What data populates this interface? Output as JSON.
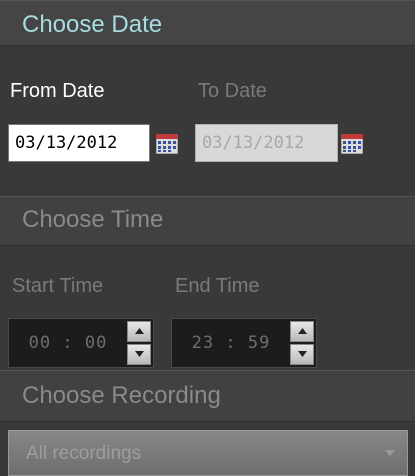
{
  "date_section": {
    "title": "Choose Date",
    "from_label": "From Date",
    "to_label": "To Date",
    "from_value": "03/13/2012",
    "to_value": "03/13/2012"
  },
  "time_section": {
    "title": "Choose Time",
    "start_label": "Start Time",
    "end_label": "End Time",
    "start_value": "00 : 00",
    "end_value": "23 : 59"
  },
  "recording_section": {
    "title": "Choose Recording",
    "selected": "All recordings"
  },
  "icons": {
    "calendar": "calendar-icon",
    "spin_up": "chevron-up-icon",
    "spin_down": "chevron-down-icon",
    "dropdown": "chevron-down-icon"
  },
  "colors": {
    "accent": "#a6dde0",
    "panel": "#393939"
  }
}
